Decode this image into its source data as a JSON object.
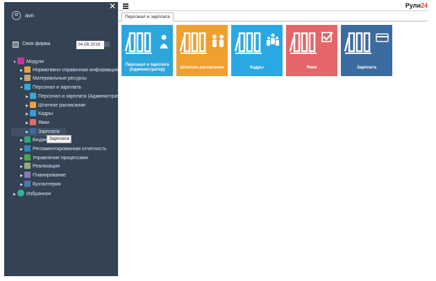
{
  "sidebar": {
    "username": "avn",
    "firm_label": "Своя фирма",
    "firm_date": "04.08.2016",
    "tree": [
      {
        "label": "Модули",
        "level": 0,
        "expanded": true,
        "icon_color": "#cc3399",
        "icon": "modules-icon"
      },
      {
        "label": "Нормативно-справочная информация",
        "level": 1,
        "expanded": false,
        "icon_color": "#e8a33c",
        "icon": "reference-icon"
      },
      {
        "label": "Материальные ресурсы",
        "level": 1,
        "expanded": false,
        "icon_color": "#c7a27a",
        "icon": "materials-icon"
      },
      {
        "label": "Персонал и зарплата",
        "level": 1,
        "expanded": true,
        "icon_color": "#39a7d7",
        "icon": "personnel-icon"
      },
      {
        "label": "Персонал и зарплата (Администратор)",
        "level": 2,
        "expanded": false,
        "icon_color": "#39a7d7",
        "icon": "admin-icon"
      },
      {
        "label": "Штатное расписание",
        "level": 2,
        "expanded": false,
        "icon_color": "#e8a33c",
        "icon": "staff-schedule-icon"
      },
      {
        "label": "Кадры",
        "level": 2,
        "expanded": false,
        "icon_color": "#2f9fe0",
        "icon": "hr-icon"
      },
      {
        "label": "Явки",
        "level": 2,
        "expanded": false,
        "icon_color": "#e06a6d",
        "icon": "attendance-icon"
      },
      {
        "label": "Зарплата",
        "level": 2,
        "expanded": false,
        "icon_color": "#3b6aa0",
        "icon": "salary-icon",
        "selected": true
      },
      {
        "label": "Бюджетирование",
        "level": 1,
        "expanded": false,
        "icon_color": "#2eaa7a",
        "icon": "budget-icon"
      },
      {
        "label": "Регламентированная отчетность",
        "level": 1,
        "expanded": false,
        "icon_color": "#2c86b8",
        "icon": "reporting-icon"
      },
      {
        "label": "Управление процессами",
        "level": 1,
        "expanded": false,
        "icon_color": "#4aa84a",
        "icon": "process-icon"
      },
      {
        "label": "Реализация",
        "level": 1,
        "expanded": false,
        "icon_color": "#9aa97b",
        "icon": "sales-icon"
      },
      {
        "label": "Планирование",
        "level": 1,
        "expanded": false,
        "icon_color": "#8a78b8",
        "icon": "planning-icon"
      },
      {
        "label": "Бухгалтерия",
        "level": 1,
        "expanded": false,
        "icon_color": "#4b79b0",
        "icon": "accounting-icon"
      },
      {
        "label": "Избранное",
        "level": 0,
        "expanded": false,
        "icon_color": "#2eb39e",
        "icon": "favorites-icon"
      }
    ],
    "tooltip": "Зарплата"
  },
  "header": {
    "brand_main": "Рули",
    "brand_accent": "24",
    "accent_color": "#e8332b"
  },
  "tabs": [
    {
      "label": "Персонал и зарплата"
    }
  ],
  "tiles": [
    {
      "line1": "Персонал и зарплата",
      "line2": "(Администратор)",
      "color": "#2ea6dc",
      "icon": "admin-person-icon"
    },
    {
      "line1": "Штатное расписание",
      "line2": "",
      "color": "#efa02f",
      "icon": "staff-people-icon"
    },
    {
      "line1": "Кадры",
      "line2": "",
      "color": "#29a8e3",
      "icon": "hr-group-icon"
    },
    {
      "line1": "Явки",
      "line2": "",
      "color": "#e46669",
      "icon": "checkbox-icon"
    },
    {
      "line1": "Зарплата",
      "line2": "",
      "color": "#3b6b9f",
      "icon": "card-icon"
    }
  ]
}
